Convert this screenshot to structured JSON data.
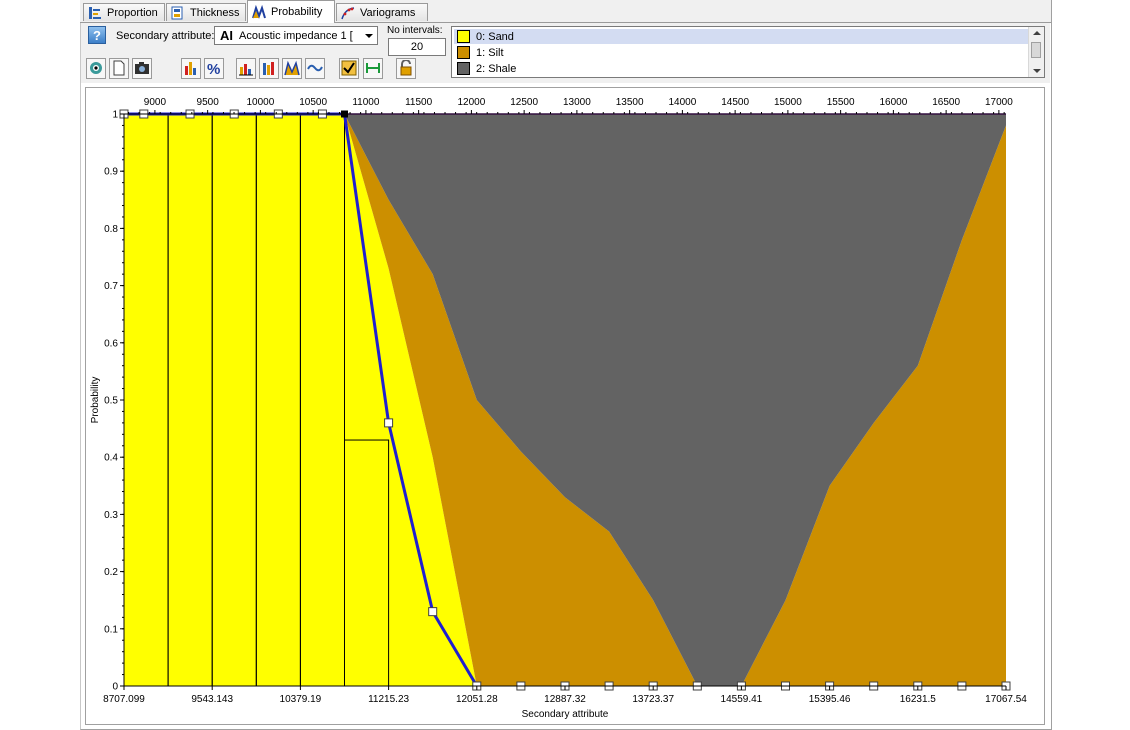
{
  "tabs": [
    {
      "label": "Proportion",
      "icon": "proportion-icon",
      "active": false
    },
    {
      "label": "Thickness",
      "icon": "thickness-icon",
      "active": false
    },
    {
      "label": "Probability",
      "icon": "probability-icon",
      "active": true
    },
    {
      "label": "Variograms",
      "icon": "variograms-icon",
      "active": false
    }
  ],
  "toolbar": {
    "help_label": "?",
    "secondary_attribute_label": "Secondary attribute:",
    "secondary_attribute_value": "Acoustic impedance 1 [",
    "attribute_type_icon_text": "AI",
    "no_intervals_label": "No intervals:",
    "no_intervals_value": "20",
    "buttons": [
      "eye-icon",
      "document-icon",
      "camera-icon",
      "histogram-icon",
      "percent-icon",
      "bar-chart-icon",
      "stacked-bar-icon",
      "cumulative-icon",
      "curve-icon",
      "checkbox-icon",
      "fit-width-icon",
      "lock-icon"
    ]
  },
  "legend": {
    "items": [
      {
        "label": "0: Sand",
        "color": "#ffff00",
        "selected": true
      },
      {
        "label": "1: Silt",
        "color": "#cc8f00",
        "selected": false
      },
      {
        "label": "2: Shale",
        "color": "#636363",
        "selected": false
      }
    ]
  },
  "chart_data": {
    "type": "area",
    "stacked": true,
    "xlabel": "Secondary attribute",
    "ylabel": "Probability",
    "xlim": [
      8707.099,
      17067.54
    ],
    "ylim": [
      0,
      1
    ],
    "yticks": [
      "0",
      "0.1",
      "0.2",
      "0.3",
      "0.4",
      "0.5",
      "0.6",
      "0.7",
      "0.8",
      "0.9",
      "1"
    ],
    "bottom_ticks": [
      8707.099,
      9543.143,
      10379.19,
      11215.23,
      12051.28,
      12887.32,
      13723.37,
      14559.41,
      15395.46,
      16231.5,
      17067.54
    ],
    "bottom_tick_labels": [
      "8707.099",
      "9543.143",
      "10379.19",
      "11215.23",
      "12051.28",
      "12887.32",
      "13723.37",
      "14559.41",
      "15395.46",
      "16231.5",
      "17067.54"
    ],
    "top_ticks": [
      9000,
      9500,
      10000,
      10500,
      11000,
      11500,
      12000,
      12500,
      13000,
      13500,
      14000,
      14500,
      15000,
      15500,
      16000,
      16500,
      17000
    ],
    "top_tick_labels": [
      "9000",
      "9500",
      "10000",
      "10500",
      "11000",
      "11500",
      "12000",
      "12500",
      "13000",
      "13500",
      "14000",
      "14500",
      "15000",
      "15500",
      "16000",
      "16500",
      "17000"
    ],
    "grid": false,
    "x": [
      8707.099,
      9125.1,
      9543.1,
      9961.2,
      10379.2,
      10797.2,
      11215.2,
      11633.3,
      12051.3,
      12469.3,
      12887.3,
      13305.3,
      13723.4,
      14141.4,
      14559.4,
      14977.4,
      15395.5,
      15813.5,
      16231.5,
      16649.5,
      17067.5
    ],
    "series": [
      {
        "name": "0: Sand",
        "color": "#ffff00",
        "values": [
          1,
          1,
          1,
          1,
          1,
          1,
          0.73,
          0.4,
          0,
          0,
          0,
          0,
          0,
          0,
          0,
          0,
          0,
          0,
          0,
          0,
          0
        ]
      },
      {
        "name": "1: Silt",
        "color": "#cc8f00",
        "values": [
          0,
          0,
          0,
          0,
          0,
          0,
          0.12,
          0.32,
          0.5,
          0.41,
          0.33,
          0.27,
          0.15,
          0,
          0,
          0.15,
          0.35,
          0.46,
          0.56,
          0.78,
          0.98
        ]
      },
      {
        "name": "2: Shale",
        "color": "#636363",
        "values": [
          0,
          0,
          0,
          0,
          0,
          0,
          0.15,
          0.28,
          0.5,
          0.59,
          0.67,
          0.73,
          0.85,
          1,
          1,
          0.85,
          0.65,
          0.54,
          0.44,
          0.22,
          0.02
        ]
      }
    ],
    "sand_bars": {
      "edges": [
        8707.099,
        9125.1,
        9543.1,
        9961.2,
        10379.2,
        10797.2,
        11215.2,
        11633.3
      ],
      "values": [
        1,
        1,
        1,
        1,
        1,
        0.43,
        0
      ]
    },
    "sand_curve": {
      "color": "#1f1fd0",
      "x": [
        8707.099,
        10797.2,
        11215.2,
        11633.3,
        12051.3
      ],
      "y": [
        1,
        1,
        0.46,
        0.13,
        0
      ],
      "markers_x": [
        8707.099,
        8895,
        9333,
        9752,
        10170,
        10588,
        11215.2,
        11633.3,
        12051.3,
        12469.3,
        12887.3,
        13305.3,
        13723.4,
        14141.4,
        14559.4,
        14977.4,
        15395.5,
        15813.5,
        16231.5,
        16649.5,
        17067.5
      ],
      "markers_y": [
        1,
        1,
        1,
        1,
        1,
        1,
        0.46,
        0.13,
        0,
        0,
        0,
        0,
        0,
        0,
        0,
        0,
        0,
        0,
        0,
        0,
        0
      ]
    }
  }
}
